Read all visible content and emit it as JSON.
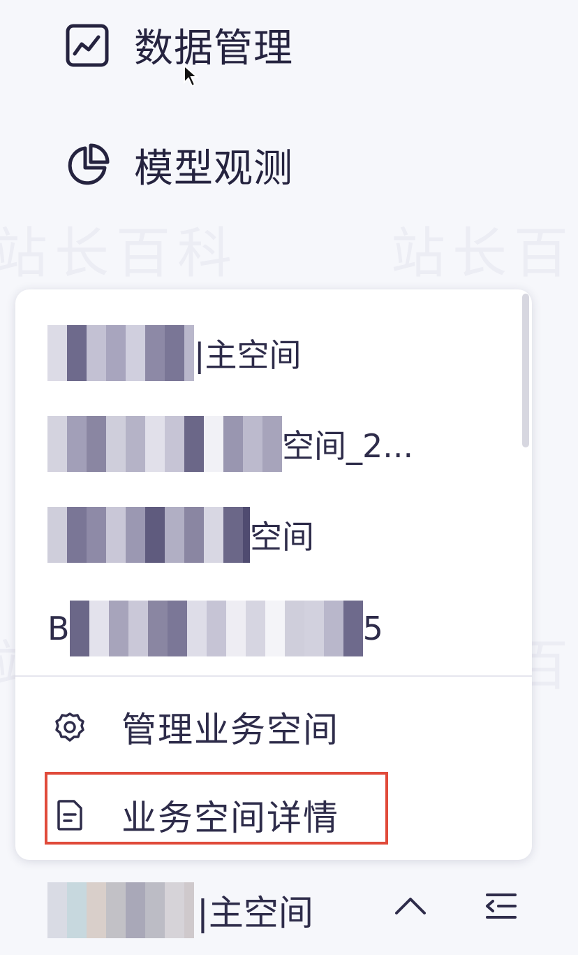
{
  "nav": [
    {
      "label": "数据管理",
      "icon": "line-chart-icon"
    },
    {
      "label": "模型观测",
      "icon": "pie-chart-icon"
    }
  ],
  "watermark": "站长百科",
  "workspace_menu": {
    "items": [
      {
        "visible_suffix": "|主空间"
      },
      {
        "visible_suffix": "空间_2..."
      },
      {
        "visible_suffix": "空间"
      },
      {
        "visible_prefix": "B",
        "visible_suffix": "5"
      }
    ],
    "actions": [
      {
        "label": "管理业务空间",
        "icon": "gear-icon"
      },
      {
        "label": "业务空间详情",
        "icon": "document-icon",
        "highlighted": true
      }
    ]
  },
  "current_workspace": {
    "visible_suffix": "|主空间"
  },
  "colors": {
    "highlight": "#e04a3a",
    "text": "#25233f",
    "background": "#f6f7fb"
  }
}
